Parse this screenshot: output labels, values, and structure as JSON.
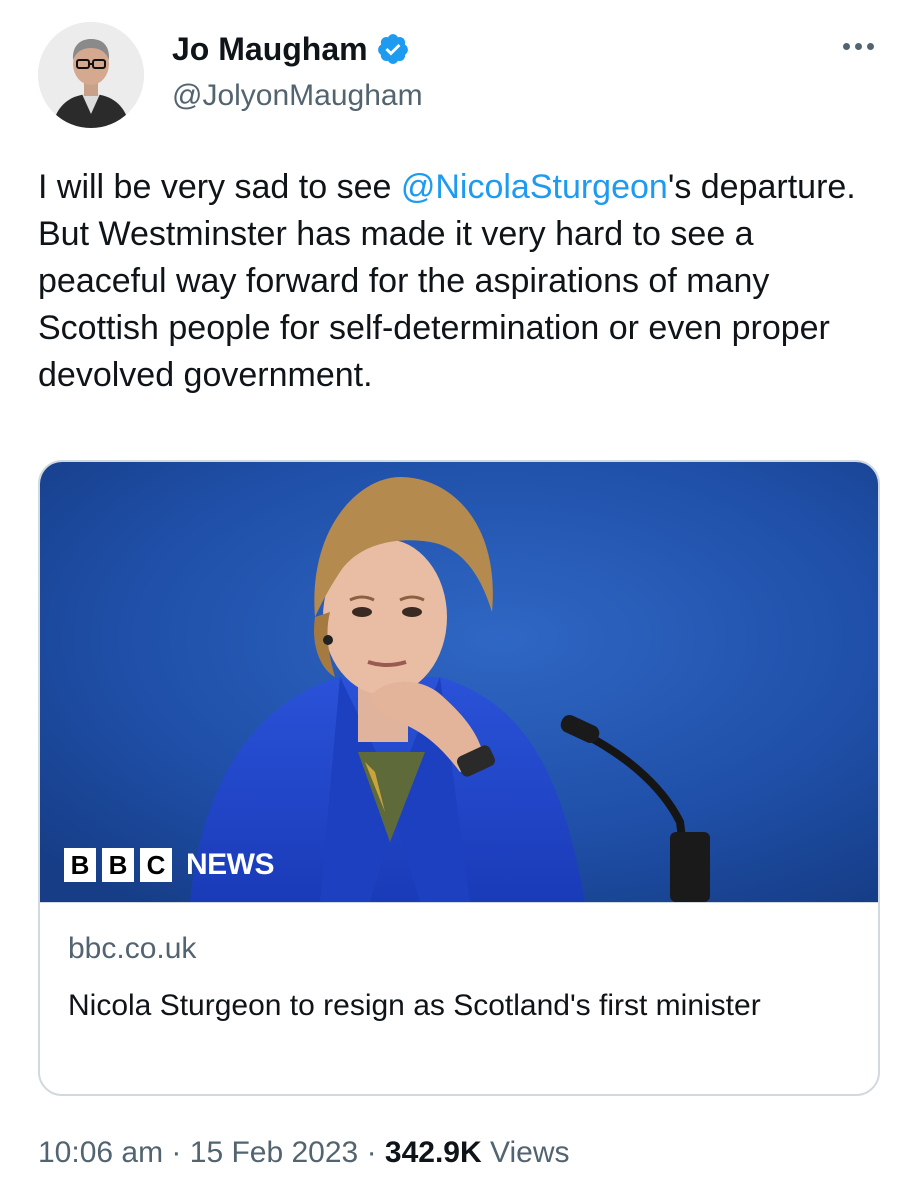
{
  "author": {
    "display_name": "Jo Maugham",
    "handle": "@JolyonMaugham",
    "verified": true,
    "verified_color": "#1d9bf0"
  },
  "more_icon": "more-horizontal-icon",
  "tweet": {
    "text_before": "I will be very sad to see ",
    "mention": "@NicolaSturgeon",
    "text_after": "'s departure. But Westminster has made it very hard to see a peaceful way forward for the aspirations of many Scottish people for self-determination or even proper devolved government."
  },
  "card": {
    "logo_letters": [
      "B",
      "B",
      "C"
    ],
    "logo_word": "NEWS",
    "domain": "bbc.co.uk",
    "title": "Nicola Sturgeon to resign as Scotland's first minister"
  },
  "meta": {
    "time": "10:06 am",
    "separator": " · ",
    "date": "15 Feb 2023",
    "views_count": "342.9K",
    "views_label": "Views"
  },
  "colors": {
    "link": "#1d9bf0",
    "secondary_text": "#536471",
    "card_background": "#1f4fa8"
  }
}
